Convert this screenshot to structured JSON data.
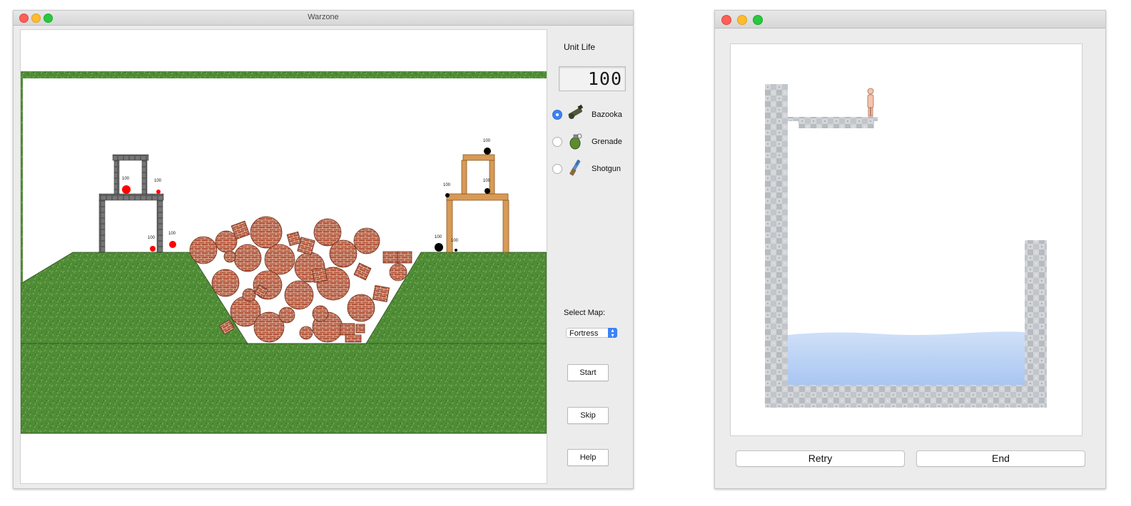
{
  "warzone": {
    "title": "Warzone",
    "unit_life_label": "Unit Life",
    "unit_life_value": "100",
    "weapons": [
      {
        "label": "Bazooka",
        "selected": true,
        "icon": "bazooka-icon"
      },
      {
        "label": "Grenade",
        "selected": false,
        "icon": "grenade-icon"
      },
      {
        "label": "Shotgun",
        "selected": false,
        "icon": "shotgun-icon"
      }
    ],
    "select_map_label": "Select Map:",
    "map_value": "Fortress",
    "buttons": {
      "start": "Start",
      "skip": "Skip",
      "help": "Help"
    },
    "unit_health": {
      "red_units": [
        "100",
        "100",
        "100",
        "100"
      ],
      "black_units": [
        "100",
        "100",
        "100",
        "100",
        "100"
      ]
    },
    "colors": {
      "team_red": "#ff0000",
      "team_black": "#000000",
      "grass": "#4e8f3a",
      "accent": "#3b82f7"
    }
  },
  "second_window": {
    "buttons": {
      "retry": "Retry",
      "end": "End"
    },
    "colors": {
      "water": "#b9d3f6",
      "stone": "#c9ccd0"
    }
  }
}
